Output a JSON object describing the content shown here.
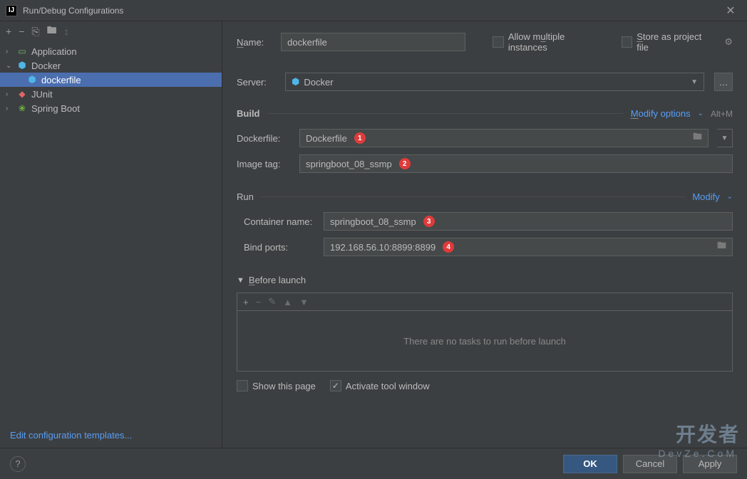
{
  "window": {
    "title": "Run/Debug Configurations"
  },
  "tree": {
    "items": [
      {
        "label": "Application",
        "type": "app",
        "expanded": false
      },
      {
        "label": "Docker",
        "type": "docker",
        "expanded": true,
        "children": [
          {
            "label": "dockerfile",
            "type": "dockerfile",
            "selected": true
          }
        ]
      },
      {
        "label": "JUnit",
        "type": "junit",
        "expanded": false
      },
      {
        "label": "Spring Boot",
        "type": "springboot",
        "expanded": false
      }
    ],
    "edit_templates": "Edit configuration templates..."
  },
  "form": {
    "name_label": "Name:",
    "name_value": "dockerfile",
    "allow_multiple": "Allow multiple instances",
    "store_project": "Store as project file",
    "server_label": "Server:",
    "server_value": "Docker",
    "build_section": "Build",
    "modify_options": "Modify options",
    "modify_shortcut": "Alt+M",
    "dockerfile_label": "Dockerfile:",
    "dockerfile_value": "Dockerfile",
    "image_tag_label": "Image tag:",
    "image_tag_value": "springboot_08_ssmp",
    "run_section": "Run",
    "modify_run": "Modify",
    "container_label": "Container name:",
    "container_value": "springboot_08_ssmp",
    "ports_label": "Bind ports:",
    "ports_value": "192.168.56.10:8899:8899",
    "before_launch": "Before launch",
    "no_tasks": "There are no tasks to run before launch",
    "show_page": "Show this page",
    "activate_tool": "Activate tool window"
  },
  "badges": {
    "dockerfile": "1",
    "image_tag": "2",
    "container": "3",
    "ports": "4"
  },
  "buttons": {
    "ok": "OK",
    "cancel": "Cancel",
    "apply": "Apply"
  },
  "watermark": {
    "main": "开发者",
    "sub": "DevZe.CoM"
  }
}
